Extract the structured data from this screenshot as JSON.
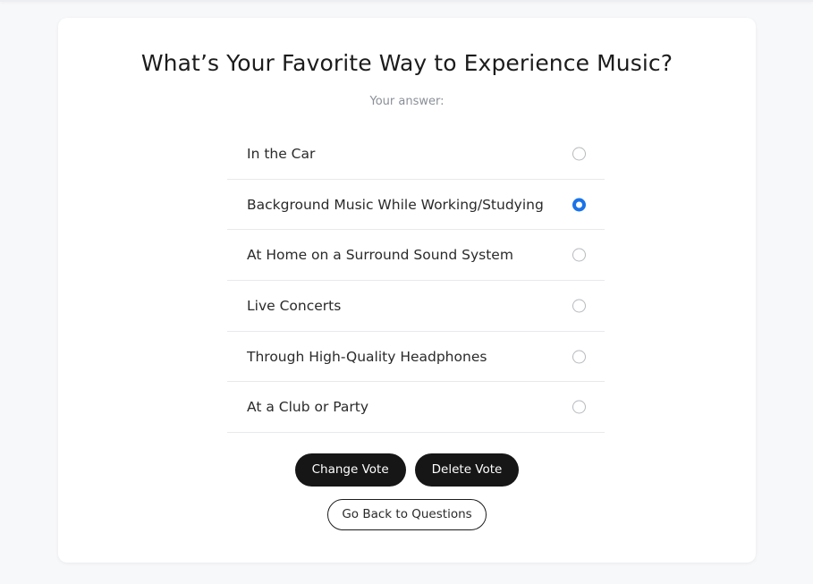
{
  "poll": {
    "question": "What’s Your Favorite Way to Experience Music?",
    "answer_label": "Your answer:",
    "selected_index": 1,
    "options": [
      {
        "label": "In the Car",
        "selected": false
      },
      {
        "label": "Background Music While Working/Studying",
        "selected": true
      },
      {
        "label": "At Home on a Surround Sound System",
        "selected": false
      },
      {
        "label": "Live Concerts",
        "selected": false
      },
      {
        "label": "Through High-Quality Headphones",
        "selected": false
      },
      {
        "label": "At a Club or Party",
        "selected": false
      }
    ]
  },
  "actions": {
    "change_vote": "Change Vote",
    "delete_vote": "Delete Vote",
    "go_back": "Go Back to Questions"
  },
  "colors": {
    "accent": "#1a73e8",
    "button_dark": "#161616",
    "background": "#f7f8fa"
  }
}
